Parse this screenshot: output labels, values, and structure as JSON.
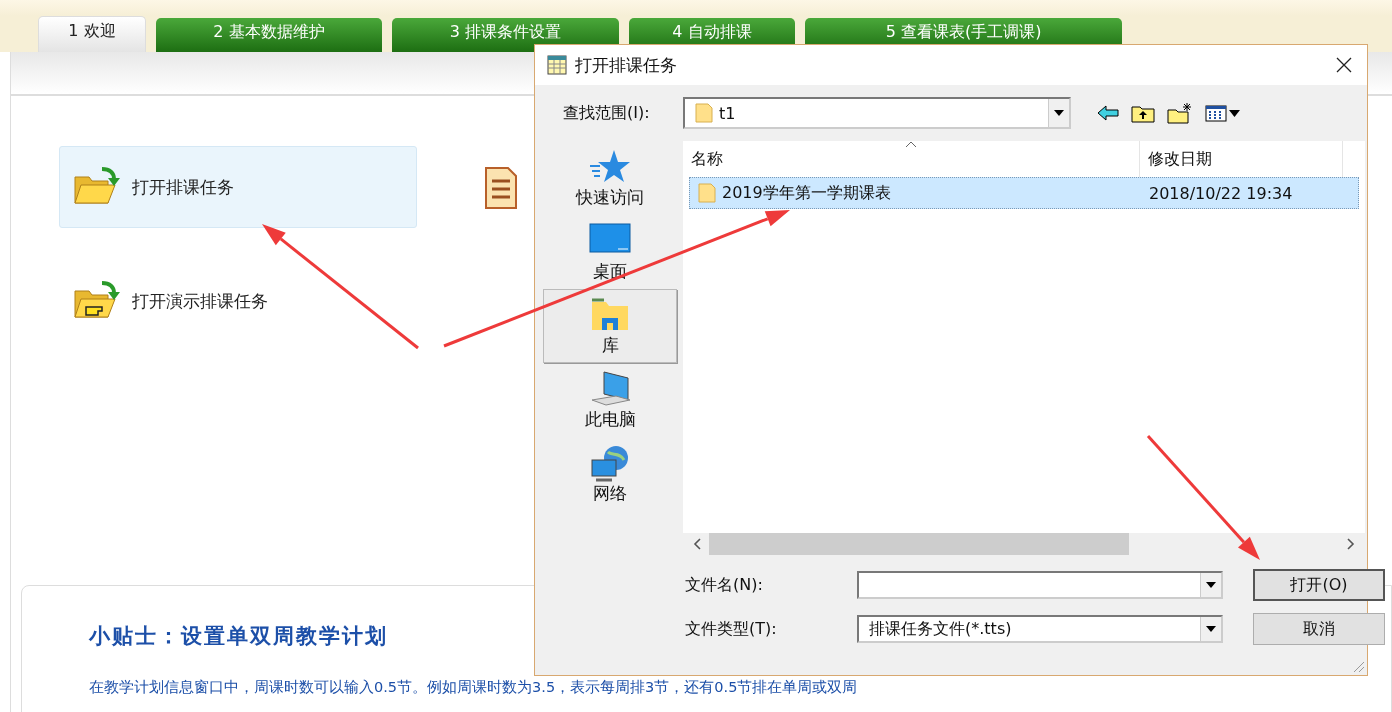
{
  "tabs": [
    {
      "label": "1 欢迎",
      "selected": true
    },
    {
      "label": "2 基本数据维护",
      "selected": false
    },
    {
      "label": "3 排课条件设置",
      "selected": false
    },
    {
      "label": "4 自动排课",
      "selected": false
    },
    {
      "label": "5 查看课表(手工调课)",
      "selected": false
    }
  ],
  "actions": [
    {
      "kind": "open",
      "label": "打开排课任务",
      "selected": true
    },
    {
      "kind": "document",
      "selected": false
    },
    {
      "kind": "demo",
      "label": "打开演示排课任务",
      "selected": false
    }
  ],
  "tip": {
    "title": "小贴士：设置单双周教学计划",
    "text": "在教学计划信息窗口中，周课时数可以输入0.5节。例如周课时数为3.5，表示每周排3节，还有0.5节排在单周或双周"
  },
  "dialog": {
    "title": "打开排课任务",
    "location_label": "查找范围(I):",
    "location_value": "t1",
    "places": [
      {
        "kind": "quick",
        "label": "快速访问",
        "selected": false
      },
      {
        "kind": "desktop",
        "label": "桌面",
        "selected": false
      },
      {
        "kind": "library",
        "label": "库",
        "selected": true
      },
      {
        "kind": "pc",
        "label": "此电脑",
        "selected": false
      },
      {
        "kind": "network",
        "label": "网络",
        "selected": false
      }
    ],
    "columns": [
      "名称",
      "修改日期"
    ],
    "files": [
      {
        "name": "2019学年第一学期课表",
        "modified": "2018/10/22 19:34",
        "selected": true
      }
    ],
    "filename_label": "文件名(N):",
    "filetype_label": "文件类型(T):",
    "filetype_value": "排课任务文件(*.tts)",
    "buttons": [
      {
        "label": "打开(O)",
        "default": true
      },
      {
        "label": "取消",
        "default": false
      }
    ]
  }
}
